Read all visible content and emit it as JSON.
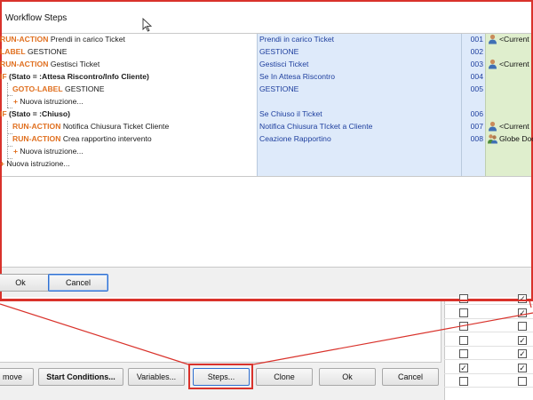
{
  "dialog": {
    "title": "Workflow Steps",
    "ok_label": "Ok",
    "cancel_label": "Cancel"
  },
  "steps": [
    {
      "keyword": "RUN-ACTION",
      "text": "Prendi in carico Ticket",
      "description": "Prendi in carico Ticket",
      "number": "001",
      "user": "<Current"
    },
    {
      "keyword": "LABEL",
      "text": "GESTIONE",
      "description": "GESTIONE",
      "number": "002",
      "user": ""
    },
    {
      "keyword": "RUN-ACTION",
      "text": "Gestisci Ticket",
      "description": "Gestisci Ticket",
      "number": "003",
      "user": "<Current"
    },
    {
      "keyword": "IF",
      "text": "(Stato = :Attesa Riscontro/Info Cliente)",
      "description": "Se In Attesa Riscontro",
      "number": "004",
      "user": ""
    },
    {
      "keyword": "GOTO-LABEL",
      "text": "GESTIONE",
      "description": "GESTIONE",
      "number": "005",
      "user": ""
    },
    {
      "keyword": "+",
      "text": "Nuova istruzione...",
      "description": "",
      "number": "",
      "user": ""
    },
    {
      "keyword": "IF",
      "text": "(Stato = :Chiuso)",
      "description": "Se Chiuso il Ticket",
      "number": "006",
      "user": ""
    },
    {
      "keyword": "RUN-ACTION",
      "text": "Notifica Chiusura Ticket Cliente",
      "description": "Notifica Chiusura TIcket a Cliente",
      "number": "007",
      "user": "<Current"
    },
    {
      "keyword": "RUN-ACTION",
      "text": "Crea rapportino intervento",
      "description": "Ceazione Rapportino",
      "number": "008",
      "user": "Globe Doc"
    },
    {
      "keyword": "+",
      "text": "Nuova istruzione...",
      "description": "",
      "number": "",
      "user": ""
    },
    {
      "keyword": "+",
      "text": "Nuova istruzione...",
      "description": "",
      "number": "",
      "user": ""
    }
  ],
  "bottom_buttons": {
    "remove": "move",
    "start_conditions": "Start Conditions...",
    "variables": "Variables...",
    "steps": "Steps...",
    "clone": "Clone",
    "ok": "Ok",
    "cancel": "Cancel"
  },
  "checkbox_rows": [
    {
      "c1": false,
      "c2": true
    },
    {
      "c1": false,
      "c2": true
    },
    {
      "c1": false,
      "c2": false
    },
    {
      "c1": false,
      "c2": true
    },
    {
      "c1": false,
      "c2": true
    },
    {
      "c1": true,
      "c2": true
    },
    {
      "c1": false,
      "c2": false
    }
  ],
  "icons": {
    "user": "user-icon",
    "group": "group-icon",
    "cursor": "mouse-cursor-icon"
  },
  "colors": {
    "keyword": "#e07020",
    "description": "#1e3f9e",
    "highlight": "#d9322b",
    "desc_bg": "#deeafa",
    "user_bg": "#dfeecd"
  }
}
